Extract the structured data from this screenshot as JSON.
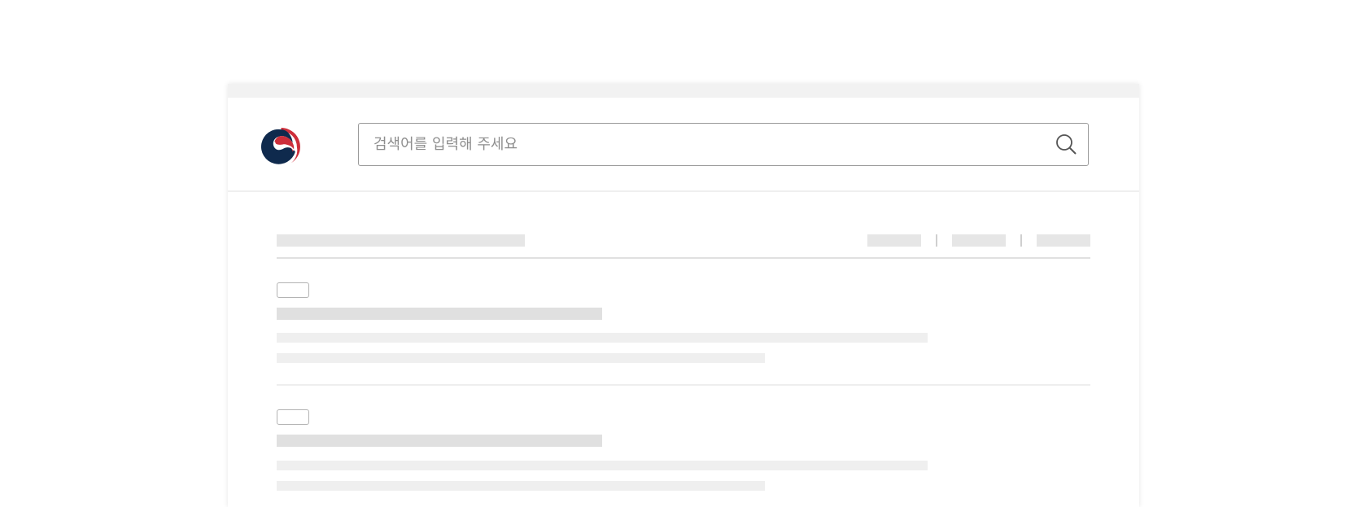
{
  "search": {
    "placeholder": "검색어를 입력해 주세요"
  },
  "icons": {
    "logo": "government-taegeuk-logo",
    "search": "search-icon"
  },
  "colors": {
    "logo_navy": "#0f2a4d",
    "logo_red": "#cd2e3a",
    "search_border": "#9a9a9a",
    "placeholder_text": "#8e8e8e",
    "skeleton": "#e6e6e6"
  },
  "results": {
    "tabs_count": 3,
    "items_count": 2
  }
}
